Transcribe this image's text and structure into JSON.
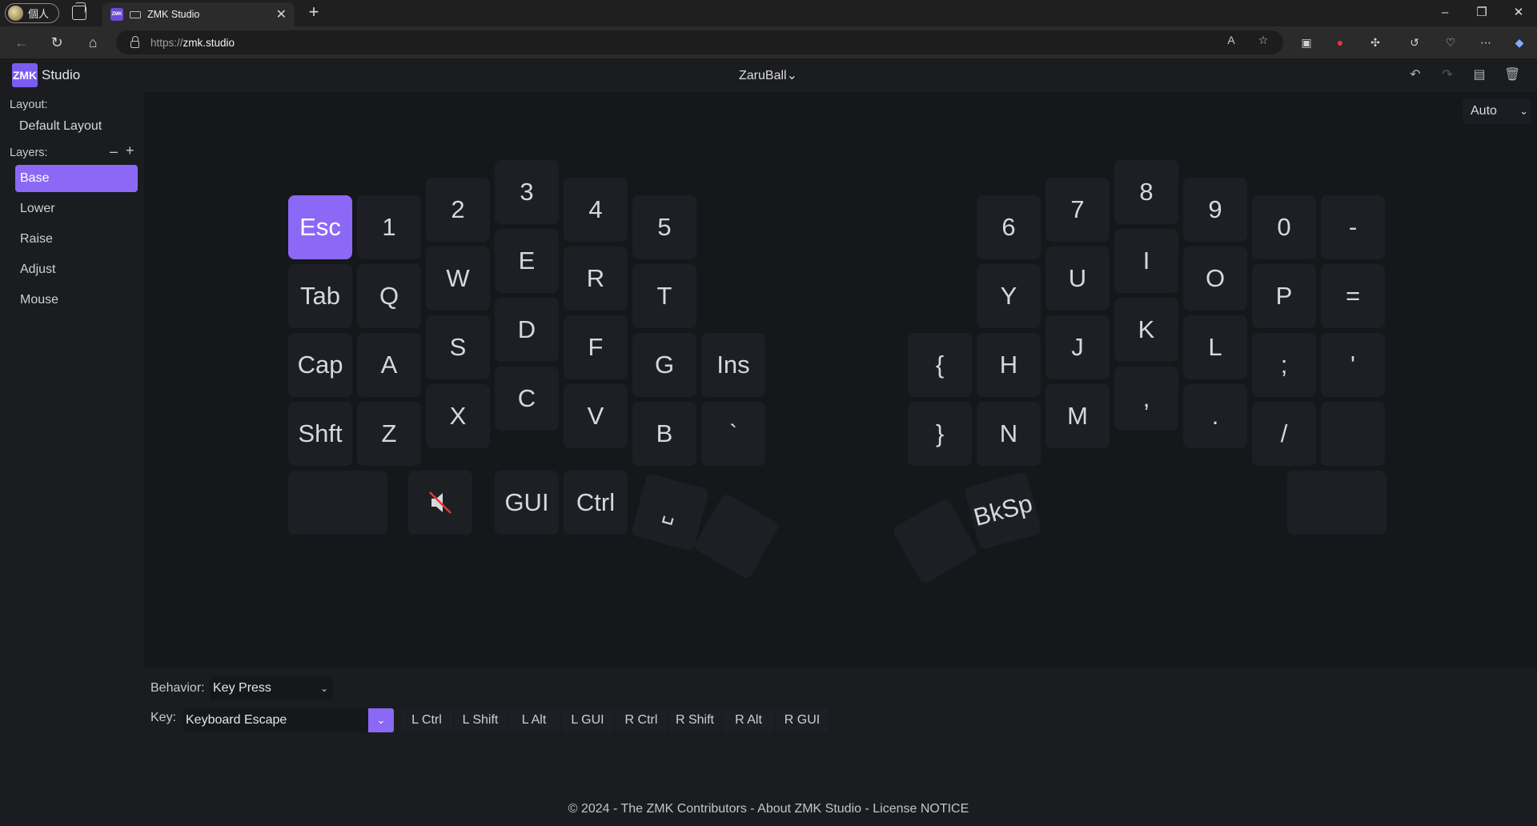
{
  "browser": {
    "profile_label": "個人",
    "tab_title": "ZMK Studio",
    "tab_favicon_text": "ZMK",
    "url_scheme": "https://",
    "url_host": "zmk.studio",
    "window_controls": [
      "minimize-icon",
      "restore-icon",
      "close-icon"
    ],
    "toolbar_icons": [
      "read-aloud-icon",
      "favorite-star-icon",
      "workspaces-icon",
      "adblock-icon",
      "extensions-icon",
      "history-icon",
      "browser-essentials-icon",
      "more-icon",
      "copilot-icon"
    ]
  },
  "header": {
    "brand_logo": "ZMK",
    "brand_name": "Studio",
    "device_name": "ZaruBall",
    "device_chevron": "⌄",
    "icons": [
      "undo-icon",
      "redo-icon",
      "save-icon",
      "discard-icon"
    ]
  },
  "sidebar": {
    "layout_label": "Layout:",
    "layout_value": "Default Layout",
    "layers_label": "Layers:",
    "remove_symbol": "–",
    "add_symbol": "+",
    "layers": [
      {
        "label": "Base",
        "active": true
      },
      {
        "label": "Lower",
        "active": false
      },
      {
        "label": "Raise",
        "active": false
      },
      {
        "label": "Adjust",
        "active": false
      },
      {
        "label": "Mouse",
        "active": false
      }
    ]
  },
  "keymap": {
    "scale_value": "Auto",
    "selected_key": "Esc",
    "keys": [
      "Esc",
      "1",
      "2",
      "3",
      "4",
      "5",
      "Tab",
      "Q",
      "W",
      "E",
      "R",
      "T",
      "Cap",
      "A",
      "S",
      "D",
      "F",
      "G",
      "Ins",
      "Shft",
      "Z",
      "X",
      "C",
      "V",
      "B",
      "`",
      "",
      "mute-icon",
      "GUI",
      "Ctrl",
      "␣",
      "",
      "6",
      "7",
      "8",
      "9",
      "0",
      "-",
      "Y",
      "U",
      "I",
      "O",
      "P",
      "=",
      "{",
      "H",
      "J",
      "K",
      "L",
      ";",
      "'",
      "}",
      "N",
      "M",
      ",",
      ".",
      "/",
      "",
      "",
      "BkSp",
      ""
    ]
  },
  "editor": {
    "behavior_label": "Behavior:",
    "behavior_value": "Key Press",
    "key_label": "Key:",
    "key_value": "Keyboard Escape",
    "modifiers": [
      "L Ctrl",
      "L Shift",
      "L Alt",
      "L GUI",
      "R Ctrl",
      "R Shift",
      "R Alt",
      "R GUI"
    ]
  },
  "footer": {
    "text": "© 2024 - The ZMK Contributors - About ZMK Studio - License NOTICE"
  }
}
